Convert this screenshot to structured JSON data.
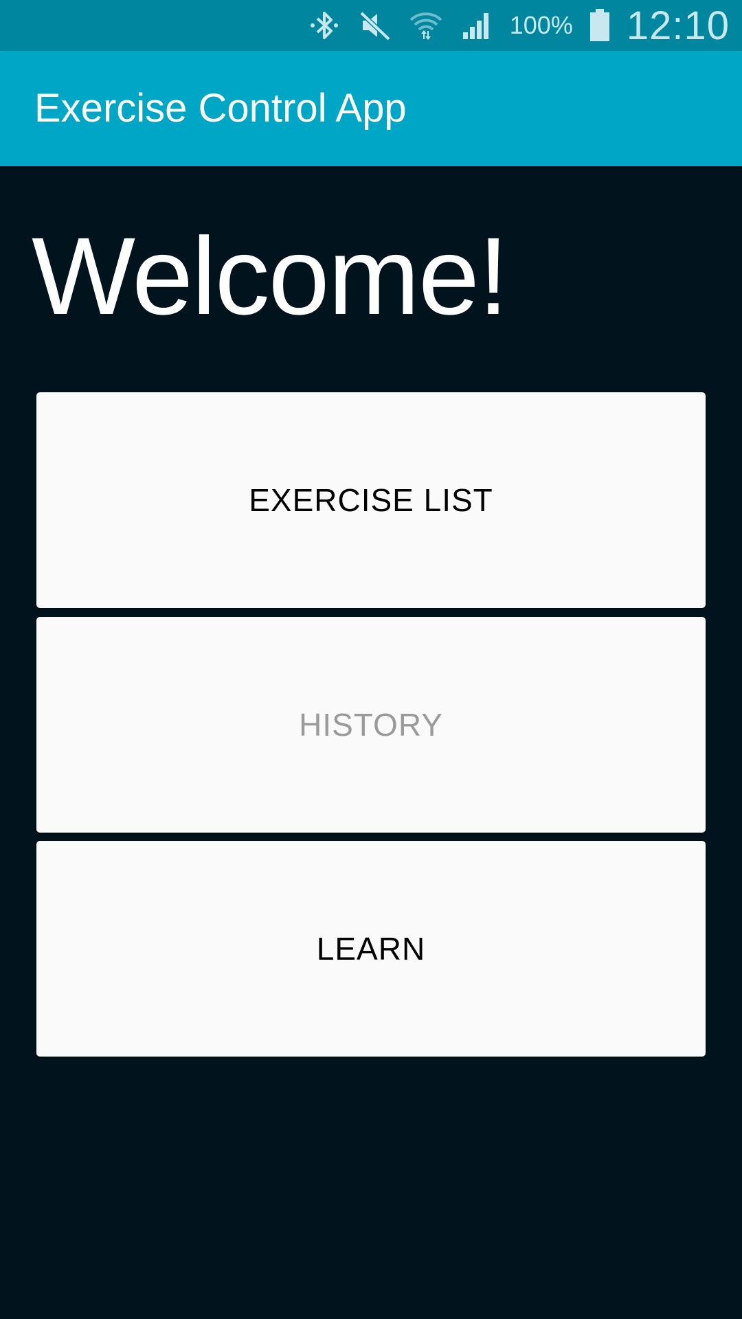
{
  "status_bar": {
    "battery_percent": "100%",
    "time": "12:10",
    "icons": [
      "bluetooth-icon",
      "mute-icon",
      "wifi-icon",
      "signal-icon",
      "battery-icon"
    ]
  },
  "app_bar": {
    "title": "Exercise Control App"
  },
  "main": {
    "heading": "Welcome!",
    "buttons": [
      {
        "label": "EXERCISE LIST",
        "enabled": true
      },
      {
        "label": "HISTORY",
        "enabled": false
      },
      {
        "label": "LEARN",
        "enabled": true
      }
    ]
  },
  "colors": {
    "status_bar": "#00869f",
    "app_bar": "#00a6c6",
    "background": "#01131c",
    "button": "#fafafa",
    "disabled_text": "#9a9a9a"
  }
}
